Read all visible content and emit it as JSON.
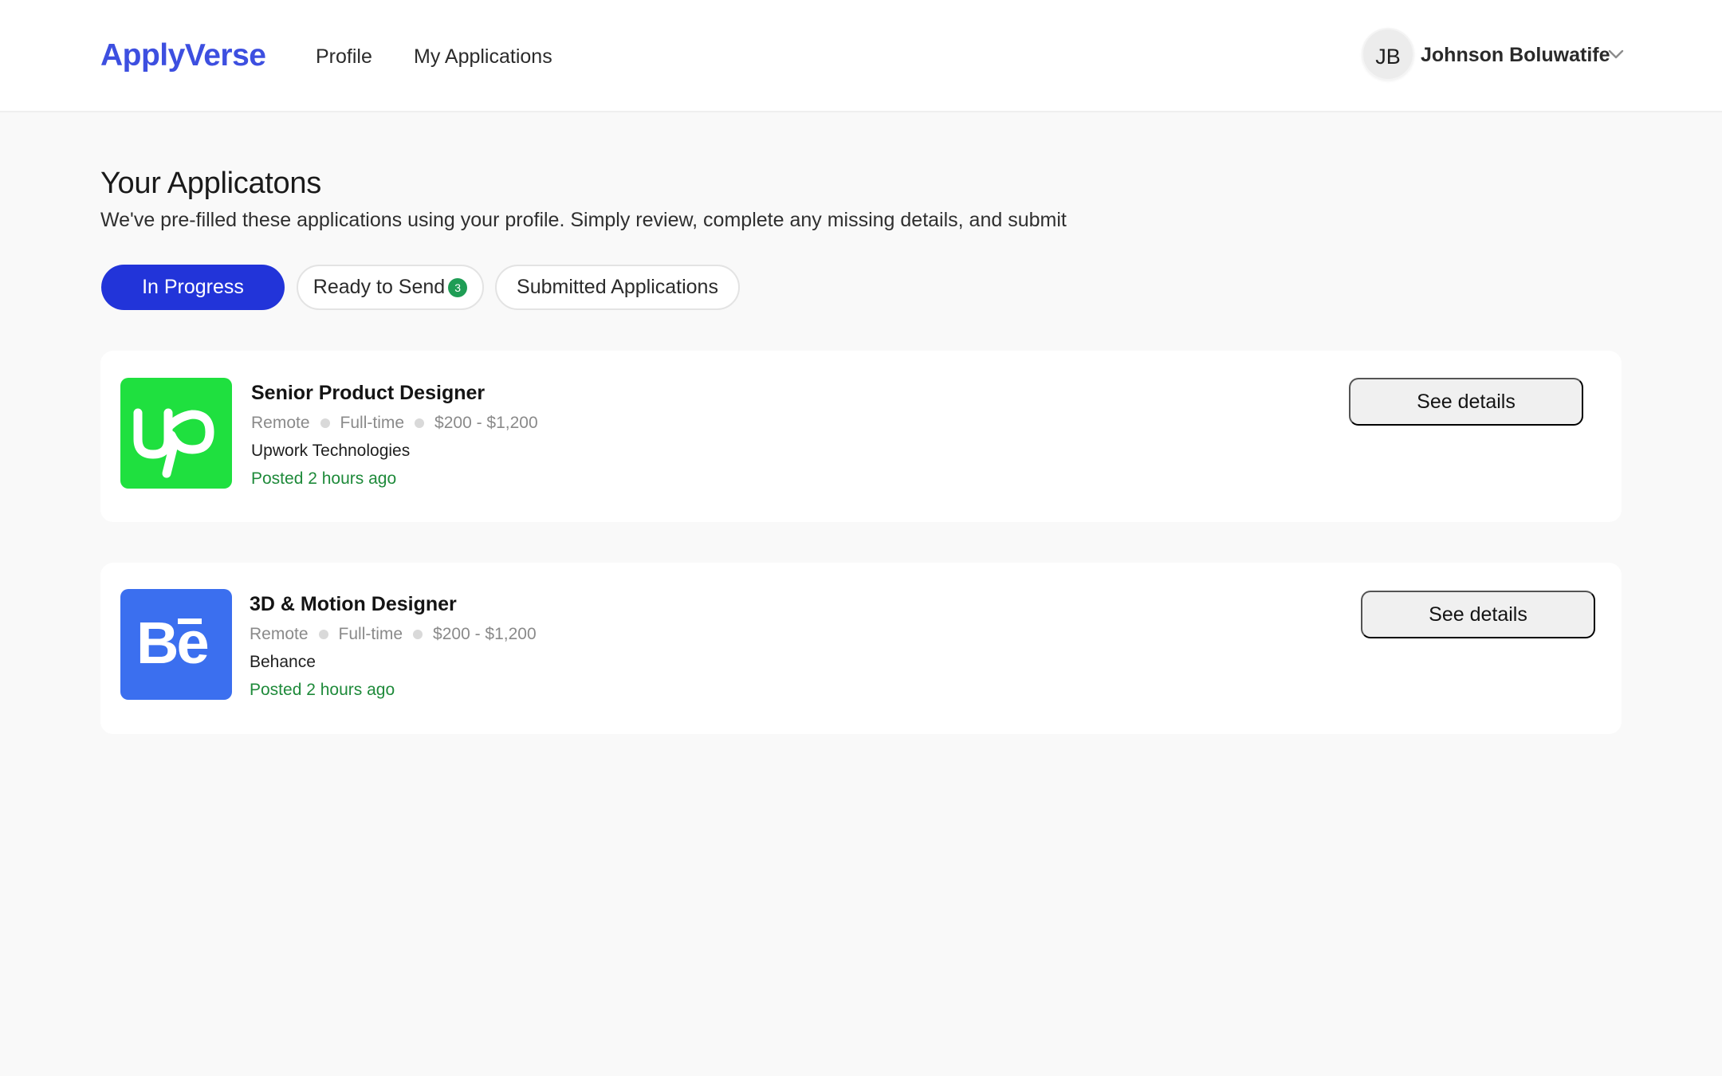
{
  "header": {
    "logo": "ApplyVerse",
    "nav": [
      {
        "label": "Profile"
      },
      {
        "label": "My Applications"
      }
    ],
    "user": {
      "initials": "JB",
      "name": "Johnson Boluwatife",
      "menu_icon": "chevron-down-icon"
    }
  },
  "page": {
    "title": "Your Applicatons",
    "subtitle": "We've pre-filled these applications using your profile. Simply review, complete any missing details, and submit"
  },
  "tabs": [
    {
      "label": "In Progress",
      "active": true
    },
    {
      "label": "Ready to Send",
      "badge": "3",
      "active": false
    },
    {
      "label": "Submitted Applications",
      "active": false
    }
  ],
  "applications": [
    {
      "title": "Senior Product Designer",
      "location": "Remote",
      "type": "Full-time",
      "salary": "$200 - $1,200",
      "company": "Upwork Technologies",
      "posted": "Posted 2 hours ago",
      "logo_icon": "upwork-logo",
      "logo_color": "#1fe03f",
      "action": "See details"
    },
    {
      "title": "3D & Motion Designer",
      "location": "Remote",
      "type": "Full-time",
      "salary": "$200 - $1,200",
      "company": "Behance",
      "posted": "Posted 2 hours ago",
      "logo_icon": "behance-logo",
      "logo_color": "#3b6fef",
      "action": "See details"
    }
  ],
  "colors": {
    "brand": "#3d4fe0",
    "active_tab": "#2234d9",
    "badge": "#1f9d55",
    "posted_text": "#1e8a3a",
    "background": "#f9f9f9"
  }
}
